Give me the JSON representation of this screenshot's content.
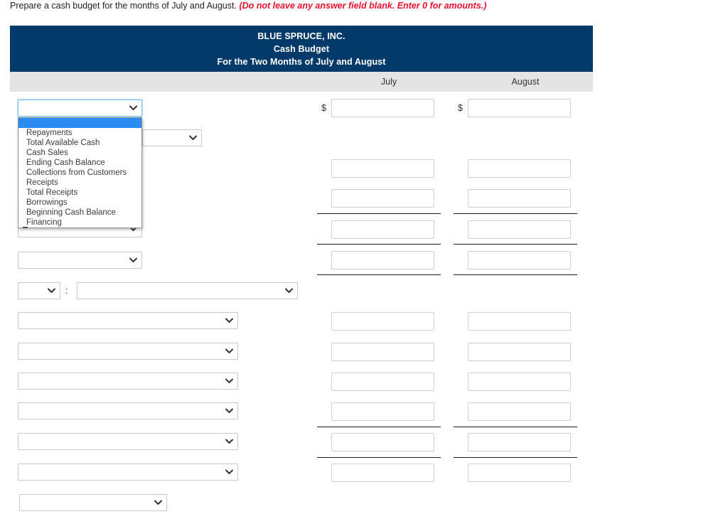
{
  "instruction": {
    "main": "Prepare a cash budget for the months of July and August. ",
    "note": "(Do not leave any answer field blank. Enter 0 for amounts.)"
  },
  "table": {
    "title_lines": [
      "BLUE SPRUCE, INC.",
      "Cash Budget",
      "For the Two Months of July and August"
    ],
    "columns": [
      "July",
      "August"
    ],
    "header_bg": "#033a69",
    "subheader_bg": "#e4e4e4"
  },
  "open_dropdown": {
    "selected_value": "",
    "highlight_color": "#2a8bf2",
    "options": [
      "",
      "Repayments",
      "Total Available Cash",
      "Cash Sales",
      "Ending Cash Balance",
      "Collections from Customers",
      "Receipts",
      "Total Receipts",
      "Borrowings",
      "Beginning Cash Balance",
      "Financing"
    ]
  },
  "rows": [
    {
      "label_value": "",
      "july": "",
      "august": "",
      "dollar": "$"
    },
    {
      "label_value": "",
      "july": "",
      "august": "",
      "dollar": ""
    },
    {
      "label_value": "",
      "july": "",
      "august": "",
      "dollar": ""
    },
    {
      "label_value": "",
      "july": "",
      "august": "",
      "dollar": ""
    },
    {
      "label_value": "",
      "july": "",
      "august": "",
      "dollar": ""
    },
    {
      "label_value": "",
      "july": "",
      "august": "",
      "dollar": ""
    },
    {
      "label_value": "",
      "july": "",
      "august": "",
      "dollar": ""
    },
    {
      "label_value": "",
      "july": "",
      "august": "",
      "dollar": ""
    },
    {
      "label_value": "",
      "july": "",
      "august": "",
      "dollar": ""
    },
    {
      "label_value": "",
      "july": "",
      "august": "",
      "dollar": ""
    },
    {
      "label_value": "",
      "july": "",
      "august": "",
      "dollar": ""
    },
    {
      "label_value": "",
      "july": "",
      "august": "",
      "dollar": ""
    },
    {
      "label_value": "",
      "july": "",
      "august": "",
      "dollar": ""
    }
  ],
  "section_row": {
    "prefix_value": "",
    "separator": ":",
    "name_value": ""
  },
  "colors": {
    "navy": "#033a69",
    "gray_band": "#e4e4e4",
    "rule": "#1a1a1a",
    "red_note": "#e8112d",
    "focus_border": "#7ec0ef"
  }
}
